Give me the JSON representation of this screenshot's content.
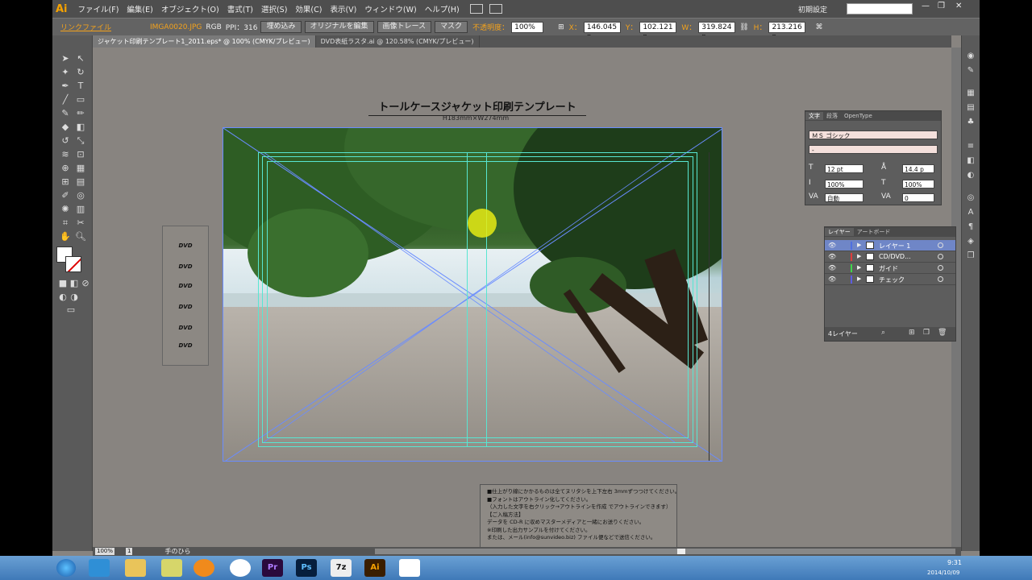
{
  "menubar": {
    "logo": "Ai",
    "items": [
      "ファイル(F)",
      "編集(E)",
      "オブジェクト(O)",
      "書式(T)",
      "選択(S)",
      "効果(C)",
      "表示(V)",
      "ウィンドウ(W)",
      "ヘルプ(H)"
    ],
    "workspace": "初期設定"
  },
  "controlbar": {
    "link_file": "リンクファイル",
    "filename": "IMGA0020.JPG",
    "color_mode": "RGB",
    "ppi": "PPI：316",
    "embed": "埋め込み",
    "edit_original": "オリジナルを編集",
    "image_trace": "画像トレース",
    "mask": "マスク",
    "opacity_label": "不透明度：",
    "opacity": "100%",
    "x_label": "X：",
    "x": "146.045 n",
    "y_label": "Y：",
    "y": "102.121 n",
    "w_label": "W：",
    "w": "319.824 n",
    "h_label": "H：",
    "h": "213.216 n"
  },
  "tabs": [
    {
      "label": "ジャケット印刷テンプレート1_2011.eps* @ 100% (CMYK/プレビュー)",
      "active": true
    },
    {
      "label": "DVD表紙ラスタ.ai @ 120.58% (CMYK/プレビュー)",
      "active": false
    }
  ],
  "document": {
    "title": "トールケースジャケット印刷テンプレート",
    "subtitle": "H183mm×W274mm",
    "notes": [
      "■仕上がり線にかかるものは全てヌリタシを上下左右 3mmずつつけてください。",
      "■フォントはアウトライン化してください。",
      "（入力した文字を右クリック→アウトラインを作成 でアウトラインできます）",
      "【ご入稿方法】",
      "データを CD-R に収めマスターメディアと一緒にお送りください。",
      "※印刷した出力サンプルを付けてください。",
      "または、メール(info@sunvideo.biz) ファイル便などで送信ください。"
    ],
    "dvd_logos": [
      "DVD",
      "DVD",
      "DVD",
      "DVD",
      "DVD",
      "DVD"
    ]
  },
  "char_panel": {
    "tabs": [
      "文字",
      "段落",
      "OpenType"
    ],
    "font": "ＭＳ ゴシック",
    "style": "-",
    "size": "12 pt",
    "leading": "14.4 p",
    "vscale": "100%",
    "hscale": "100%",
    "kerning": "自動",
    "tracking": "0"
  },
  "layers_panel": {
    "tabs": [
      "レイヤー",
      "アートボード"
    ],
    "layers": [
      {
        "name": "レイヤー 1",
        "color": "#4f6fe0",
        "selected": true
      },
      {
        "name": "CD/DVD...",
        "color": "#e03b3b",
        "selected": false
      },
      {
        "name": "ガイド",
        "color": "#3fd64a",
        "selected": false
      },
      {
        "name": "チェック",
        "color": "#5c5ce0",
        "selected": false
      }
    ],
    "count": "4レイヤー"
  },
  "statusbar": {
    "zoom": "100%",
    "page": "1",
    "tool": "手のひら"
  },
  "taskbar": {
    "apps": [
      "Pr",
      "Ps",
      "7z",
      "Ai"
    ],
    "time": "9:31",
    "date": "2014/10/09"
  },
  "colors": {
    "accent_orange": "#f3a21c",
    "guide_cyan": "#58e6d2",
    "selection_blue": "#6a8cff"
  }
}
